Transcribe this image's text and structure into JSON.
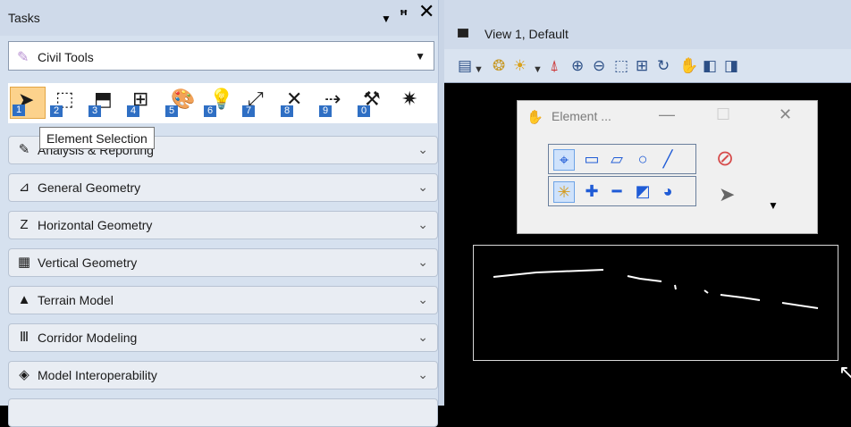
{
  "tasks": {
    "title": "Tasks",
    "workflow": "Civil Tools",
    "tools": [
      {
        "icon": "arrow-select-icon",
        "glyph": "➤",
        "key": "1",
        "selected": true
      },
      {
        "icon": "fence-icon",
        "glyph": "⬚",
        "key": "2"
      },
      {
        "icon": "place-fence-icon",
        "glyph": "⬒",
        "key": "3"
      },
      {
        "icon": "fit-view-icon",
        "glyph": "⊞",
        "key": "4"
      },
      {
        "icon": "palette-icon",
        "glyph": "🎨",
        "key": "5"
      },
      {
        "icon": "analyze-icon",
        "glyph": "💡",
        "key": "6"
      },
      {
        "icon": "measure-icon",
        "glyph": "⤢",
        "key": "7"
      },
      {
        "icon": "delete-icon",
        "glyph": "✕",
        "key": "8"
      },
      {
        "icon": "connect-icon",
        "glyph": "⇢",
        "key": "9"
      },
      {
        "icon": "tools-icon",
        "glyph": "⚒",
        "key": "0"
      },
      {
        "icon": "settings-icon",
        "glyph": "✷",
        "key": ""
      }
    ],
    "tooltip": "Element Selection",
    "groups": [
      {
        "icon": "analysis-icon",
        "glyph": "✎",
        "label": "Analysis & Reporting"
      },
      {
        "icon": "general-geometry-icon",
        "glyph": "⊿",
        "label": "General Geometry"
      },
      {
        "icon": "horizontal-geometry-icon",
        "glyph": "Z",
        "label": "Horizontal Geometry"
      },
      {
        "icon": "vertical-geometry-icon",
        "glyph": "▦",
        "label": "Vertical Geometry"
      },
      {
        "icon": "terrain-model-icon",
        "glyph": "▲",
        "label": "Terrain Model"
      },
      {
        "icon": "corridor-modeling-icon",
        "glyph": "Ⅲ",
        "label": "Corridor Modeling"
      },
      {
        "icon": "model-interoperability-icon",
        "glyph": "◈",
        "label": "Model Interoperability"
      }
    ]
  },
  "view": {
    "title": "View 1, Default"
  },
  "element_dialog": {
    "title": "Element ..."
  },
  "colors": {
    "panel_bg": "#d6e1ef",
    "selected_tool": "#fcd28c",
    "key_badge": "#2f6fc4"
  }
}
